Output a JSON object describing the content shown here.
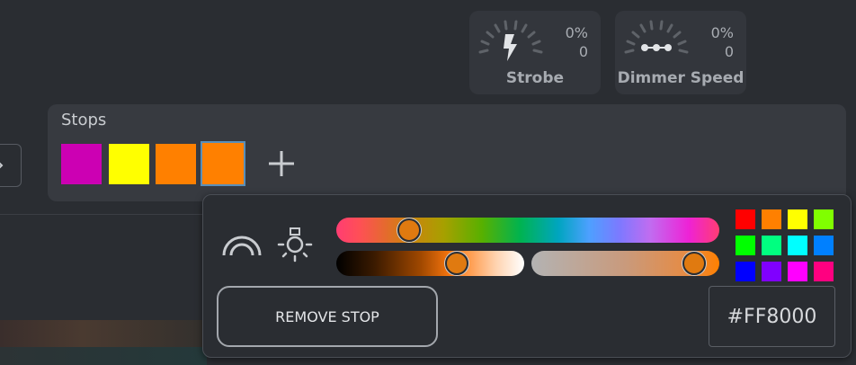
{
  "knobs": [
    {
      "label": "Strobe",
      "percent": "0%",
      "value": "0",
      "icon": "lightning-icon"
    },
    {
      "label": "Dimmer Speed",
      "percent": "0%",
      "value": "0",
      "icon": "dots-line-icon"
    }
  ],
  "stops": {
    "title": "Stops",
    "swatches": [
      "#cc00b3",
      "#ffff00",
      "#ff8000",
      "#ff8000"
    ],
    "selected_index": 3,
    "add_icon": "plus-icon"
  },
  "picker": {
    "icons": [
      "rainbow-icon",
      "lightbulb-icon"
    ],
    "hue_level": 0.17,
    "lightness_level": 0.66,
    "saturation_level": 0.92,
    "remove_label": "REMOVE STOP",
    "hex_value": "#FF8000",
    "palette": [
      "#ff0000",
      "#ff8000",
      "#ffff00",
      "#80ff00",
      "#00ff00",
      "#00ff80",
      "#00ffff",
      "#0080ff",
      "#0000ff",
      "#8000ff",
      "#ff00ff",
      "#ff0080"
    ]
  }
}
